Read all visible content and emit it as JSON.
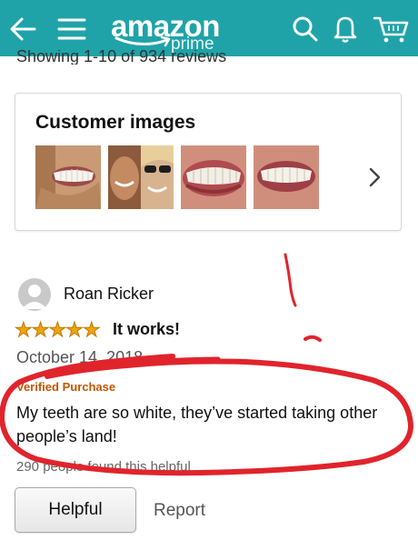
{
  "header": {
    "logo_word": "amazon",
    "logo_tag": "prime",
    "icons": [
      "back-arrow-icon",
      "menu-icon",
      "search-icon",
      "bell-icon",
      "cart-icon"
    ],
    "bar_color": "#1fa3a8"
  },
  "reviews_summary": {
    "showing_text": "Showing 1-10 of 934 reviews"
  },
  "customer_images": {
    "title": "Customer images",
    "thumbnails": [
      "smile-photo-1",
      "selfie-photo-2",
      "teeth-closeup-3",
      "teeth-closeup-4"
    ]
  },
  "review": {
    "reviewer_name": "Roan Ricker",
    "rating": 5,
    "stars_text": "★★★★★",
    "headline": "It works!",
    "date": "October 14, 2018",
    "verified": "Verified Purchase",
    "body": "My teeth are so white, they’ve started taking other people’s land!",
    "helpful_count": "290 people found this helpful",
    "helpful_label": "Helpful",
    "report_label": "Report"
  },
  "colors": {
    "star": "#f0a30a",
    "verified": "#c45500",
    "annotation": "#e0242c"
  }
}
